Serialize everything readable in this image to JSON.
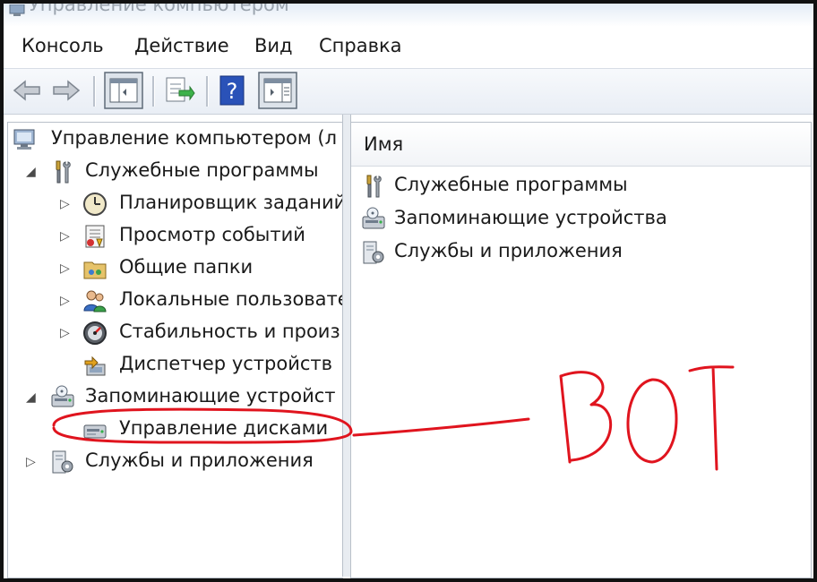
{
  "window": {
    "title": "Управление компьютером"
  },
  "menu": [
    "Консоль",
    "Действие",
    "Вид",
    "Справка"
  ],
  "tree": {
    "root": "Управление компьютером (л",
    "utilities": {
      "label": "Служебные программы",
      "children": [
        "Планировщик заданий",
        "Просмотр событий",
        "Общие папки",
        "Локальные пользовате",
        "Стабильность и произ",
        "Диспетчер устройств"
      ]
    },
    "storage": {
      "label": "Запоминающие устройст",
      "children": [
        "Управление дисками"
      ]
    },
    "services": {
      "label": "Службы и приложения"
    }
  },
  "list": {
    "column_name": "Имя",
    "items": [
      "Служебные программы",
      "Запоминающие устройства",
      "Службы и приложения"
    ]
  },
  "annotation": {
    "text": "ВОТ",
    "color": "#e0141e"
  },
  "colors": {
    "frame": "#111111",
    "annotation_red": "#e0141e",
    "help_blue": "#2a52b8"
  }
}
